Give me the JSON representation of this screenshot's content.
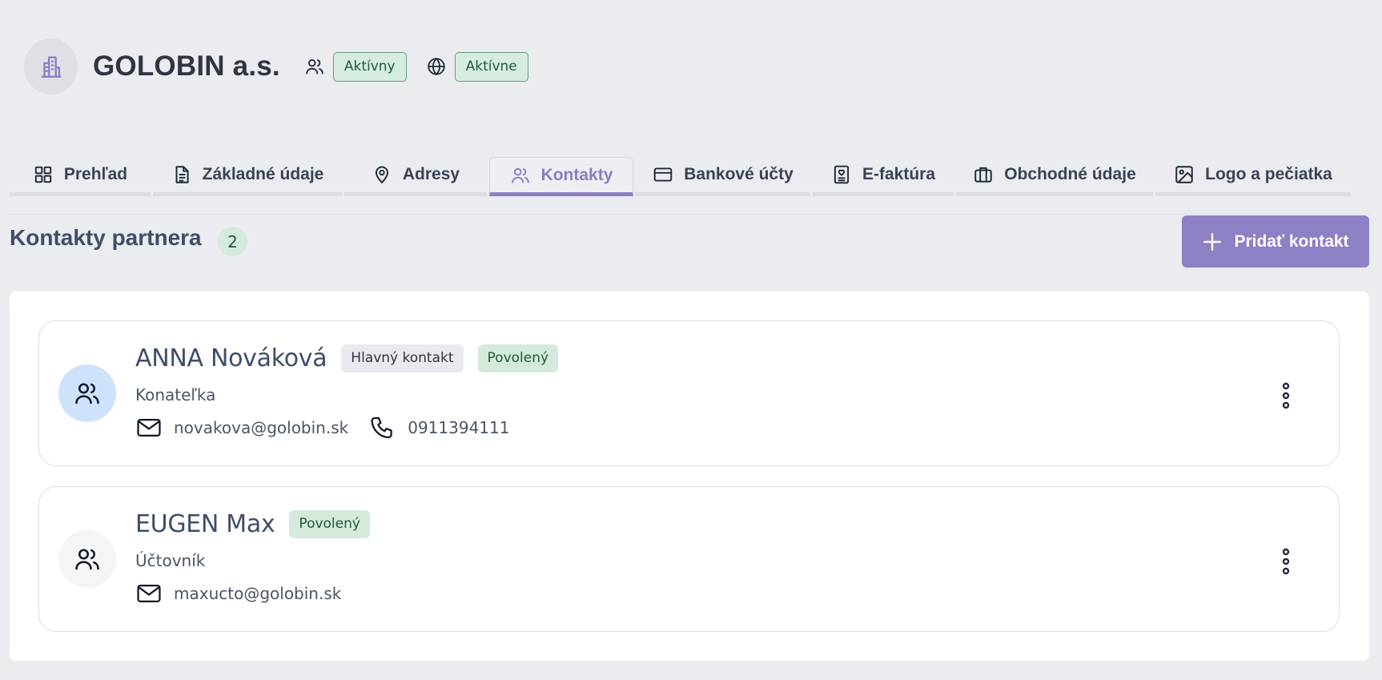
{
  "header": {
    "company_name": "GOLOBIN a.s.",
    "status_people": "Aktívny",
    "status_web": "Aktívne"
  },
  "tabs": [
    {
      "label": "Prehľad",
      "icon": "grid-icon"
    },
    {
      "label": "Základné údaje",
      "icon": "document-icon"
    },
    {
      "label": "Adresy",
      "icon": "map-pin-icon"
    },
    {
      "label": "Kontakty",
      "icon": "users-icon",
      "active": true
    },
    {
      "label": "Bankové účty",
      "icon": "credit-card-icon"
    },
    {
      "label": "E-faktúra",
      "icon": "e-invoice-icon"
    },
    {
      "label": "Obchodné údaje",
      "icon": "briefcase-icon"
    },
    {
      "label": "Logo a pečiatka",
      "icon": "image-icon"
    }
  ],
  "section": {
    "title": "Kontakty partnera",
    "count": "2",
    "add_label": "Pridať kontakt"
  },
  "contacts": [
    {
      "name": "ANNA Nováková",
      "tags": [
        "Hlavný kontakt",
        "Povolený"
      ],
      "role": "Konateľka",
      "email": "novakova@golobin.sk",
      "phone": "0911394111"
    },
    {
      "name": "EUGEN Max",
      "tags": [
        "Povolený"
      ],
      "role": "Účtovník",
      "email": "maxucto@golobin.sk"
    }
  ],
  "colors": {
    "accent": "#8e80c4",
    "background": "#ebecf0",
    "success_bg": "#d3eadc",
    "success_text": "#1f5a3c"
  }
}
